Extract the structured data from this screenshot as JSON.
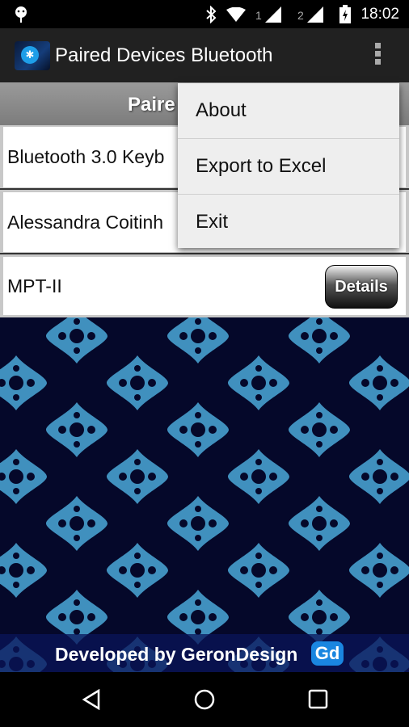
{
  "status_bar": {
    "time": "18:02",
    "sim1": "1",
    "sim2": "2",
    "icons": [
      "android-debug-icon",
      "bluetooth-icon",
      "wifi-icon",
      "signal-icon",
      "signal-icon",
      "battery-charging-icon"
    ]
  },
  "action_bar": {
    "title": "Paired Devices Bluetooth",
    "overflow_icon": "more-vert-icon"
  },
  "list": {
    "header": "Paire",
    "devices": [
      {
        "name": "Bluetooth 3.0 Keyb"
      },
      {
        "name": "Alessandra Coitinh"
      },
      {
        "name": "MPT-II",
        "button": "Details"
      }
    ]
  },
  "menu": {
    "items": [
      "About",
      "Export to Excel",
      "Exit"
    ]
  },
  "footer": {
    "text": "Developed by GeronDesign",
    "logo": "Gd"
  },
  "colors": {
    "action_bar": "#212121",
    "pattern_bg": "#05082a",
    "pattern_fg": "#4aa8d8",
    "menu_bg": "#eeeeee"
  }
}
